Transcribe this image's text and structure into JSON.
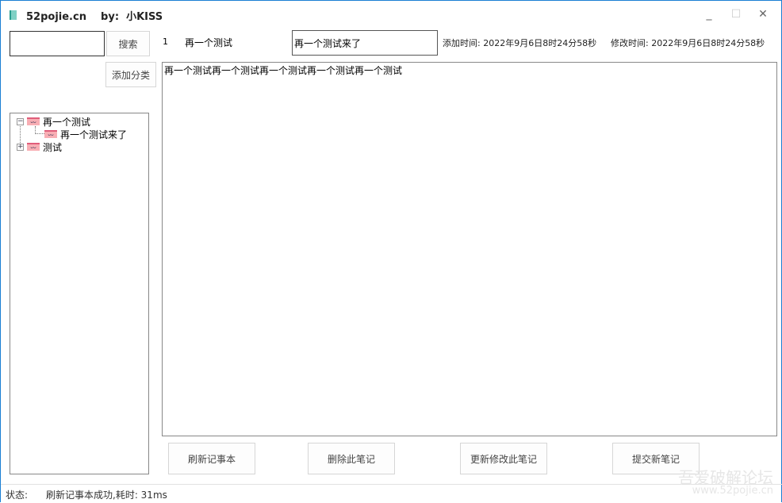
{
  "window": {
    "title": "52pojie.cn    by:  小KISS",
    "minimize": "_",
    "maximize": "☐",
    "close": "✕"
  },
  "search": {
    "value": "",
    "button": "搜索"
  },
  "add_category_button": "添加分类",
  "tree": [
    {
      "label": "再一个测试",
      "expanded": true,
      "children": [
        {
          "label": "再一个测试来了"
        }
      ]
    },
    {
      "label": "测试",
      "expanded": false
    }
  ],
  "note": {
    "id": "1",
    "category": "再一个测试",
    "title": "再一个测试来了",
    "added": "添加时间: 2022年9月6日8时24分58秒",
    "modified": "修改时间: 2022年9月6日8时24分58秒",
    "content": "再一个测试再一个测试再一个测试再一个测试再一个测试"
  },
  "buttons": {
    "refresh": "刷新记事本",
    "delete": "删除此笔记",
    "update": "更新修改此笔记",
    "submit": "提交新笔记"
  },
  "status": {
    "label": "状态:",
    "text": "刷新记事本成功,耗时: 31ms"
  },
  "watermark": {
    "line1": "吾爱破解论坛",
    "line2": "www.52pojie.cn"
  }
}
